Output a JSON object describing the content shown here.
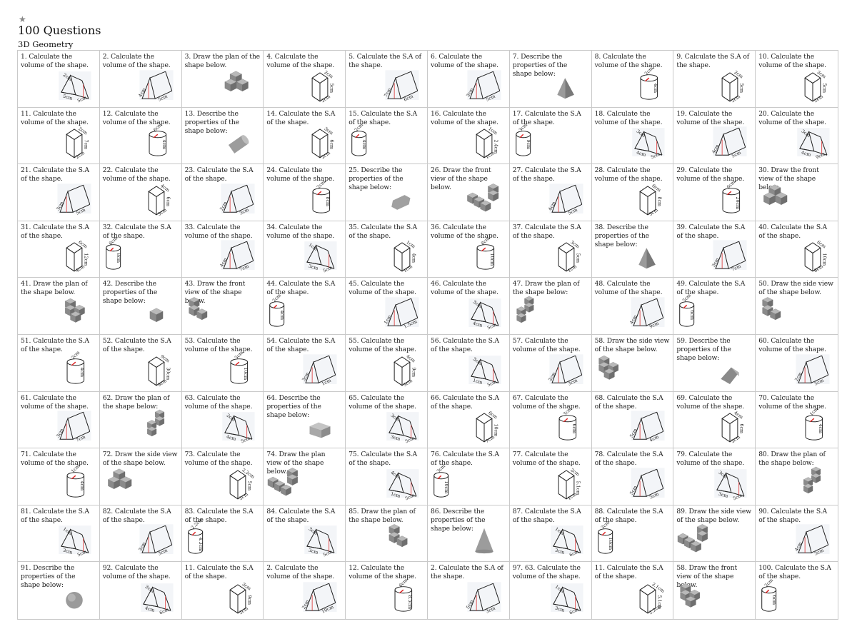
{
  "header": {
    "star_icon": "star-icon",
    "title": "100 Questions",
    "subtitle": "3D Geometry"
  },
  "questions": [
    {
      "text": "1. Calculate the volume of the shape.",
      "shape": "prism",
      "labels": [
        "2cm",
        "5cm",
        "5cm"
      ]
    },
    {
      "text": "2. Calculate the volume of the shape.",
      "shape": "tri-prism",
      "labels": [
        "4cm",
        "5cm"
      ]
    },
    {
      "text": "3. Draw the plan of the shape below.",
      "shape": "cubes-stack"
    },
    {
      "text": "4. Calculate the volume of the shape.",
      "shape": "cuboid",
      "labels": [
        "2cm",
        "5cm",
        "2cm"
      ]
    },
    {
      "text": "5. Calculate the S.A of the shape.",
      "shape": "tri-prism",
      "labels": [
        "7cm",
        "6cm",
        "8cm",
        "7cm"
      ]
    },
    {
      "text": "6. Calculate the volume of the shape.",
      "shape": "tri-prism",
      "labels": [
        "3cm",
        "5cm"
      ]
    },
    {
      "text": "7. Describe the properties of the shape below:",
      "shape": "pyramid"
    },
    {
      "text": "8. Calculate the volume of the shape.",
      "shape": "cylinder",
      "labels": [
        "2cm",
        "4cm"
      ]
    },
    {
      "text": "9. Calculate the S.A of the shape.",
      "shape": "cuboid",
      "labels": [
        "2cm",
        "5cm",
        "2cm"
      ]
    },
    {
      "text": "10. Calculate the volume of the shape.",
      "shape": "cuboid",
      "labels": [
        "3cm",
        "5cm",
        "2cm"
      ]
    },
    {
      "text": "11. Calculate the volume of the shape.",
      "shape": "cuboid",
      "labels": [
        "2cm",
        "7cm",
        "2cm"
      ]
    },
    {
      "text": "12. Calculate the volume of the shape.",
      "shape": "cylinder",
      "labels": [
        "6cm",
        "4cm"
      ]
    },
    {
      "text": "13. Describe the properties of the shape below:",
      "shape": "solid-cylinder"
    },
    {
      "text": "14. Calculate the S.A of the shape.",
      "shape": "cuboid",
      "labels": [
        "3cm",
        "6cm",
        "2cm"
      ]
    },
    {
      "text": "15. Calculate the S.A of the shape.",
      "shape": "cylinder-left",
      "labels": [
        "2cm",
        "4cm"
      ]
    },
    {
      "text": "16. Calculate the volume of the shape.",
      "shape": "cuboid",
      "labels": [
        "1cm",
        "2.4cm",
        "1cm"
      ]
    },
    {
      "text": "17. Calculate the S.A of the shape.",
      "shape": "cylinder-left",
      "labels": [
        "3cm",
        "9cm"
      ]
    },
    {
      "text": "18. Calculate the volume of the shape.",
      "shape": "prism",
      "labels": [
        "3cm",
        "4cm",
        "4cm",
        "5cm"
      ]
    },
    {
      "text": "19. Calculate the volume of the shape.",
      "shape": "tri-prism",
      "labels": [
        "4cm",
        "5cm"
      ]
    },
    {
      "text": "20. Calculate the volume of the shape.",
      "shape": "prism",
      "labels": [
        "3cm",
        "4cm",
        "9cm"
      ]
    },
    {
      "text": "21. Calculate the S.A of the shape.",
      "shape": "tri-prism",
      "labels": [
        "3cm",
        "5cm"
      ]
    },
    {
      "text": "22. Calculate the volume of the shape.",
      "shape": "cuboid",
      "labels": [
        "4cm",
        "6cm",
        "3cm"
      ]
    },
    {
      "text": "23. Calculate the S.A of the shape.",
      "shape": "tri-prism",
      "labels": [
        "2cm",
        "3cm"
      ]
    },
    {
      "text": "24. Calculate the volume of the shape.",
      "shape": "cylinder",
      "labels": [
        "2cm",
        "8cm"
      ]
    },
    {
      "text": "25. Describe the properties of the shape below:",
      "shape": "hex-prism"
    },
    {
      "text": "26. Draw the front view of the shape below.",
      "shape": "cubes-L"
    },
    {
      "text": "27. Calculate the S.A of the shape.",
      "shape": "tri-prism",
      "labels": [
        "4cm",
        "5cm"
      ]
    },
    {
      "text": "28. Calculate the volume of the shape.",
      "shape": "cuboid",
      "labels": [
        "6cm",
        "8cm",
        "5cm"
      ]
    },
    {
      "text": "29. Calculate the volume of the shape.",
      "shape": "cylinder",
      "labels": [
        "6cm",
        "20cm"
      ]
    },
    {
      "text": "30. Draw the front view of the shape below.",
      "shape": "cubes-stack-left"
    },
    {
      "text": "31. Calculate the S.A of the shape.",
      "shape": "cuboid",
      "labels": [
        "6cm",
        "12cm",
        "4cm"
      ]
    },
    {
      "text": "32. Calculate the S.A of the shape.",
      "shape": "cylinder-left",
      "labels": [
        "6cm",
        "8cm"
      ]
    },
    {
      "text": "33. Calculate the volume of the shape.",
      "shape": "tri-prism",
      "labels": [
        "4cm",
        "7cm"
      ]
    },
    {
      "text": "34. Calculate the volume of the shape.",
      "shape": "prism",
      "labels": [
        "1cm",
        "3cm",
        "3cm",
        "5cm"
      ]
    },
    {
      "text": "35. Calculate the S.A of the shape.",
      "shape": "cuboid",
      "labels": [
        "1cm",
        "4cm",
        "1cm"
      ]
    },
    {
      "text": "36. Calculate the volume of the shape.",
      "shape": "cylinder",
      "labels": [
        "8cm",
        "10cm"
      ]
    },
    {
      "text": "37. Calculate the S.A of the shape.",
      "shape": "cuboid",
      "labels": [
        "3cm",
        "5cm",
        "1cm"
      ]
    },
    {
      "text": "38. Describe the properties of the shape below:",
      "shape": "pyramid"
    },
    {
      "text": "39. Calculate the S.A of the shape.",
      "shape": "tri-prism",
      "labels": [
        "3cm",
        "7cm"
      ]
    },
    {
      "text": "40. Calculate the S.A of the shape.",
      "shape": "cuboid",
      "labels": [
        "6cm",
        "10cm",
        "6cm"
      ]
    },
    {
      "text": "41. Draw the plan of the shape below.",
      "shape": "cubes-U"
    },
    {
      "text": "42. Describe the properties of the shape below:",
      "shape": "cube"
    },
    {
      "text": "43. Draw the front view of the shape below.",
      "shape": "cubes-step-left"
    },
    {
      "text": "44. Calculate the S.A of the shape.",
      "shape": "cylinder-left",
      "labels": [
        "2cm",
        "4cm"
      ]
    },
    {
      "text": "45. Calculate the volume of the shape.",
      "shape": "tri-prism",
      "labels": [
        "1cm",
        "1.5cm"
      ]
    },
    {
      "text": "46. Calculate the volume of the shape.",
      "shape": "prism",
      "labels": [
        "3cm",
        "4cm",
        "4cm",
        "5cm"
      ]
    },
    {
      "text": "47. Draw the plan of the shape below:",
      "shape": "cubes-Z-left"
    },
    {
      "text": "48. Calculate the volume of the shape.",
      "shape": "tri-prism",
      "labels": [
        "4cm",
        "9cm"
      ]
    },
    {
      "text": "49. Calculate the S.A of the shape.",
      "shape": "cylinder-left",
      "labels": [
        "3cm",
        "6cm"
      ]
    },
    {
      "text": "50. Draw the side view of the shape below.",
      "shape": "cubes-step-left"
    },
    {
      "text": "51. Calculate the S.A of the shape.",
      "shape": "cylinder",
      "labels": [
        "2cm",
        "4cm"
      ]
    },
    {
      "text": "52. Calculate the S.A of the shape.",
      "shape": "cuboid",
      "labels": [
        "9cm",
        "30cm",
        "9cm"
      ]
    },
    {
      "text": "53. Calculate the volume of the shape.",
      "shape": "cylinder",
      "labels": [
        "3cm",
        "10cm"
      ]
    },
    {
      "text": "54. Calculate the S.A of the shape.",
      "shape": "tri-prism",
      "labels": [
        "3cm",
        "1cm",
        "3cm",
        "3cm"
      ]
    },
    {
      "text": "55. Calculate the volume of the shape.",
      "shape": "cuboid",
      "labels": [
        "4cm",
        "9cm",
        "3cm"
      ]
    },
    {
      "text": "56. Calculate the S.A of the shape.",
      "shape": "prism",
      "labels": [
        "3cm",
        "1cm",
        "4cm",
        "5cm",
        "5cm"
      ]
    },
    {
      "text": "57. Calculate the volume of the shape.",
      "shape": "tri-prism",
      "labels": [
        "2cm",
        "3cm"
      ]
    },
    {
      "text": "58. Draw the side view of the shape below.",
      "shape": "cubes-U-left"
    },
    {
      "text": "59. Describe the properties of the shape below:",
      "shape": "wedge"
    },
    {
      "text": "60. Calculate the volume of the shape.",
      "shape": "tri-prism",
      "labels": [
        "2cm",
        "5cm"
      ]
    },
    {
      "text": "61. Calculate the volume of the shape.",
      "shape": "tri-prism",
      "labels": [
        "3cm",
        "7cm"
      ]
    },
    {
      "text": "62. Draw the plan of the shape below:",
      "shape": "cubes-Z"
    },
    {
      "text": "63. Calculate the volume of the shape.",
      "shape": "prism",
      "labels": [
        "2cm",
        "4cm",
        "4cm",
        "5cm"
      ]
    },
    {
      "text": "64. Describe the properties of the shape below:",
      "shape": "solid-cuboid"
    },
    {
      "text": "65. Calculate the volume of the shape.",
      "shape": "prism",
      "labels": [
        "3cm",
        "3cm",
        "4cm",
        "5cm"
      ]
    },
    {
      "text": "66. Calculate the S.A of the shape.",
      "shape": "cuboid",
      "labels": [
        "6cm",
        "10cm",
        "7cm"
      ]
    },
    {
      "text": "67. Calculate the volume of the shape.",
      "shape": "cylinder",
      "labels": [
        "3cm",
        "6cm"
      ]
    },
    {
      "text": "68. Calculate the S.A of the shape.",
      "shape": "tri-prism",
      "labels": [
        "5cm",
        "4cm",
        "3cm",
        "4cm"
      ]
    },
    {
      "text": "69. Calculate the volume of the shape.",
      "shape": "cuboid",
      "labels": [
        "4cm",
        "6cm",
        "2cm"
      ]
    },
    {
      "text": "70. Calculate the volume of the shape.",
      "shape": "cylinder",
      "labels": [
        "1cm",
        "4cm"
      ]
    },
    {
      "text": "71. Calculate the volume of the shape.",
      "shape": "cylinder",
      "labels": [
        "1cm",
        "4cm"
      ]
    },
    {
      "text": "72. Draw the side view of the shape below.",
      "shape": "cubes-stack-left"
    },
    {
      "text": "73. Calculate the volume of the shape.",
      "shape": "cuboid",
      "labels": [
        "2.2cm",
        "5cm",
        "2cm"
      ]
    },
    {
      "text": "74. Draw the plan view of the shape below.",
      "shape": "cubes-L-left"
    },
    {
      "text": "75. Calculate the S.A of the shape.",
      "shape": "prism",
      "labels": [
        "4cm",
        "1cm",
        "3cm",
        "4cm",
        "5cm"
      ]
    },
    {
      "text": "76. Calculate the S.A of the shape.",
      "shape": "cylinder-left",
      "labels": [
        "3cm",
        "10cm"
      ]
    },
    {
      "text": "77. Calculate the volume of the shape.",
      "shape": "cuboid",
      "labels": [
        "2cm",
        "5.1cm",
        "1cm"
      ]
    },
    {
      "text": "78. Calculate the S.A of the shape.",
      "shape": "tri-prism",
      "labels": [
        "5cm",
        "3cm",
        "4cm",
        "4cm"
      ]
    },
    {
      "text": "79. Calculate the volume of the shape.",
      "shape": "prism",
      "labels": [
        "3cm",
        "3cm",
        "3cm",
        "5cm"
      ]
    },
    {
      "text": "80. Draw the plan of the shape below:",
      "shape": "cubes-Z"
    },
    {
      "text": "81. Calculate the S.A of the shape.",
      "shape": "prism",
      "labels": [
        "1cm",
        "3cm",
        "3cm",
        "4cm",
        "5cm"
      ]
    },
    {
      "text": "82. Calculate the S.A of the shape.",
      "shape": "tri-prism",
      "labels": [
        "3cm",
        "3cm",
        "3cm"
      ]
    },
    {
      "text": "83. Calculate the S.A of the shape.",
      "shape": "cylinder-left",
      "labels": [
        "2.2cm",
        "4.3cm"
      ]
    },
    {
      "text": "84. Calculate the S.A of the shape.",
      "shape": "prism",
      "labels": [
        "3cm",
        "3cm",
        "3cm",
        "4cm",
        "5cm"
      ]
    },
    {
      "text": "85. Draw the plan of the shape below.",
      "shape": "cubes-step"
    },
    {
      "text": "86. Describe the properties of the shape below:",
      "shape": "cone"
    },
    {
      "text": "87. Calculate the S.A of the shape.",
      "shape": "prism",
      "labels": [
        "1cm",
        "3cm",
        "3cm",
        "4cm",
        "6cm"
      ]
    },
    {
      "text": "88. Calculate the S.A of the shape.",
      "shape": "cylinder-left",
      "labels": [
        "3cm",
        "18cm"
      ]
    },
    {
      "text": "89. Draw the side view of the shape below.",
      "shape": "cubes-L-left"
    },
    {
      "text": "90. Calculate the S.A of the shape.",
      "shape": "tri-prism",
      "labels": [
        "4cm",
        "3cm",
        "5cm"
      ]
    },
    {
      "text": "91. Describe the properties of the shape below:",
      "shape": "sphere"
    },
    {
      "text": "92. Calculate the volume of the shape.",
      "shape": "prism",
      "labels": [
        "3cm",
        "4cm",
        "4cm",
        "6cm"
      ]
    },
    {
      "text": "11. Calculate the S.A of the shape.",
      "shape": "cuboid",
      "labels": [
        "3cm",
        "9cm",
        "2cm"
      ]
    },
    {
      "text": "2. Calculate the volume of the shape.",
      "shape": "tri-prism",
      "labels": [
        "2cm",
        "10cm"
      ]
    },
    {
      "text": "12. Calculate the volume of the shape.",
      "shape": "cylinder",
      "labels": [
        "6cm",
        "8.5cm"
      ]
    },
    {
      "text": "2. Calculate the S.A of the shape.",
      "shape": "tri-prism",
      "labels": [
        "5cm",
        "3cm",
        "4cm",
        "2cm"
      ]
    },
    {
      "text": "97. 63. Calculate the volume of the shape.",
      "shape": "prism",
      "labels": [
        "1cm",
        "3cm",
        "4cm",
        "6cm"
      ]
    },
    {
      "text": "11. Calculate the S.A of the shape.",
      "shape": "cuboid",
      "labels": [
        "2.1cm",
        "5.1cm",
        "2.2cm"
      ]
    },
    {
      "text": "58. Draw the front view of the shape below.",
      "shape": "cubes-U-left"
    },
    {
      "text": "100. Calculate the S.A of the shape.",
      "shape": "cylinder-left",
      "labels": [
        "2cm",
        "6cm"
      ]
    }
  ]
}
